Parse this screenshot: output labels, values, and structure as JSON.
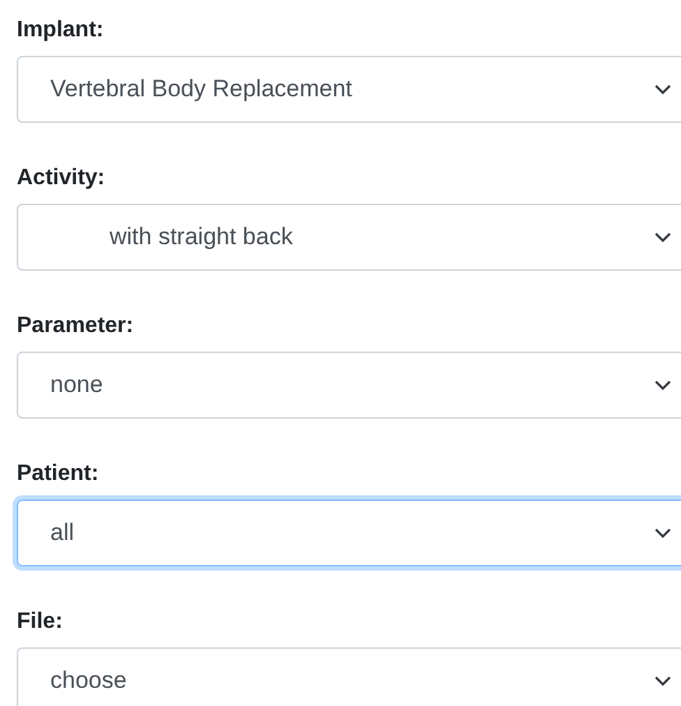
{
  "fields": [
    {
      "label": "Implant:",
      "value": "Vertebral Body Replacement",
      "focused": false
    },
    {
      "label": "Activity:",
      "value": "         with straight back",
      "focused": false
    },
    {
      "label": "Parameter:",
      "value": "none",
      "focused": false
    },
    {
      "label": "Patient:",
      "value": "all",
      "focused": true
    },
    {
      "label": "File:",
      "value": "choose",
      "focused": false
    }
  ]
}
